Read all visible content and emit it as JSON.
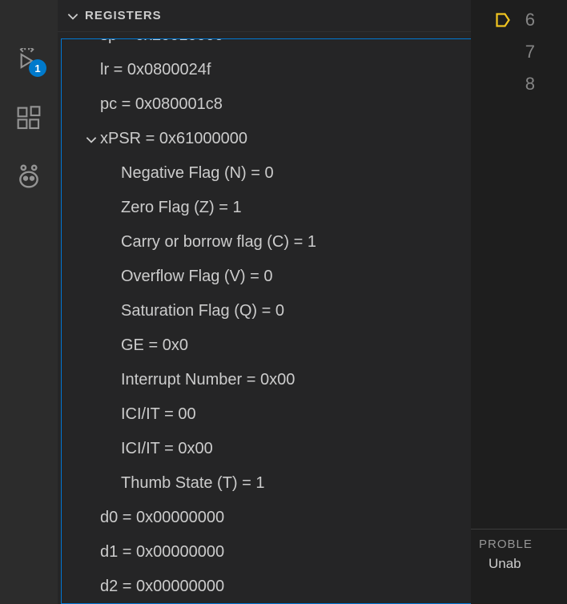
{
  "activityBar": {
    "debugBadge": "1"
  },
  "panel": {
    "title": "REGISTERS"
  },
  "registers": {
    "lr": "lr = 0x0800024f",
    "pc": "pc = 0x080001c8",
    "xpsr": "xPSR = 0x61000000",
    "flags": {
      "n": "Negative Flag (N) = 0",
      "z": "Zero Flag (Z) = 1",
      "c": "Carry or borrow flag (C) = 1",
      "v": "Overflow Flag (V) = 0",
      "q": "Saturation Flag (Q) = 0",
      "ge": "GE = 0x0",
      "interrupt": "Interrupt Number = 0x00",
      "ici1": "ICI/IT = 00",
      "ici2": "ICI/IT = 0x00",
      "thumb": "Thumb State (T) = 1"
    },
    "d0": "d0 = 0x00000000",
    "d1": "d1 = 0x00000000",
    "d2": "d2 = 0x00000000"
  },
  "editor": {
    "line6": "6",
    "line7": "7",
    "line8": "8"
  },
  "bottomPanel": {
    "problemsTab": "PROBLE",
    "content": "Unab"
  }
}
